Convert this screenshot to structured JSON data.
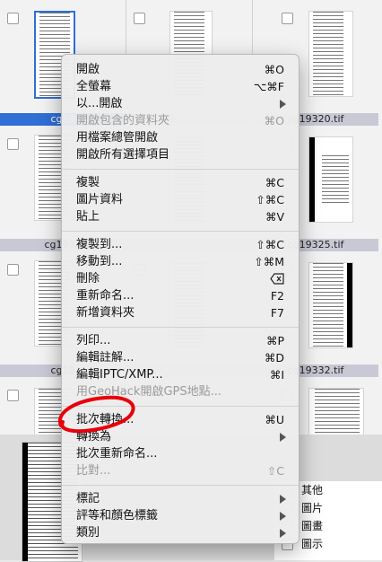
{
  "grid": {
    "cells": [
      {
        "caption": "cg19",
        "selected": true
      },
      {
        "caption": "",
        "selected": false
      },
      {
        "caption": "cg19320.tif",
        "selected": false
      },
      {
        "caption": "cg1932",
        "selected": false
      },
      {
        "caption": "",
        "selected": false
      },
      {
        "caption": "cg19325.tif",
        "selected": false
      },
      {
        "caption": "cg19",
        "selected": false
      },
      {
        "caption": "",
        "selected": false
      },
      {
        "caption": "cg19332.tif",
        "selected": false
      }
    ]
  },
  "menu": {
    "items": [
      {
        "label": "開啟",
        "shortcut": "⌘O",
        "disabled": false
      },
      {
        "label": "全螢幕",
        "shortcut": "⌥⌘F",
        "disabled": false
      },
      {
        "label": "以...開啟",
        "shortcut": "",
        "submenu": true,
        "disabled": false
      },
      {
        "label": "開啟包含的資料夾",
        "shortcut": "⌘O",
        "disabled": true
      },
      {
        "label": "用檔案總管開啟",
        "shortcut": "",
        "disabled": false
      },
      {
        "label": "開啟所有選擇項目",
        "shortcut": "",
        "disabled": false
      },
      {
        "label": "複製",
        "shortcut": "⌘C",
        "disabled": false
      },
      {
        "label": "圖片資料",
        "shortcut": "⇧⌘C",
        "disabled": false
      },
      {
        "label": "貼上",
        "shortcut": "⌘V",
        "disabled": false
      },
      {
        "label": "複製到...",
        "shortcut": "⇧⌘C",
        "disabled": false
      },
      {
        "label": "移動到...",
        "shortcut": "⇧⌘M",
        "disabled": false
      },
      {
        "label": "刪除",
        "shortcut": "",
        "deletekey": true,
        "disabled": false
      },
      {
        "label": "重新命名...",
        "shortcut": "F2",
        "disabled": false
      },
      {
        "label": "新增資料夾",
        "shortcut": "F7",
        "disabled": false
      },
      {
        "label": "列印...",
        "shortcut": "⌘P",
        "disabled": false
      },
      {
        "label": "編輯註解...",
        "shortcut": "⌘D",
        "disabled": false
      },
      {
        "label": "編輯IPTC/XMP...",
        "shortcut": "⌘I",
        "disabled": false
      },
      {
        "label": "用GeoHack開啟GPS地點...",
        "shortcut": "",
        "disabled": true
      },
      {
        "label": "批次轉換...",
        "shortcut": "⌘U",
        "disabled": false
      },
      {
        "label": "轉換為",
        "shortcut": "",
        "submenu": true,
        "disabled": false
      },
      {
        "label": "批次重新命名...",
        "shortcut": "",
        "disabled": false
      },
      {
        "label": "比對...",
        "shortcut": "⇧C",
        "disabled": true
      },
      {
        "label": "標記",
        "shortcut": "",
        "submenu": true,
        "disabled": false
      },
      {
        "label": "評等和顏色標籤",
        "shortcut": "",
        "submenu": true,
        "disabled": false
      },
      {
        "label": "類別",
        "shortcut": "",
        "submenu": true,
        "disabled": false
      }
    ]
  },
  "tags": [
    "其他",
    "圖片",
    "圖畫",
    "圖示"
  ],
  "colors": {
    "selection": "#2f6fd6",
    "annotation": "#e8000b"
  }
}
